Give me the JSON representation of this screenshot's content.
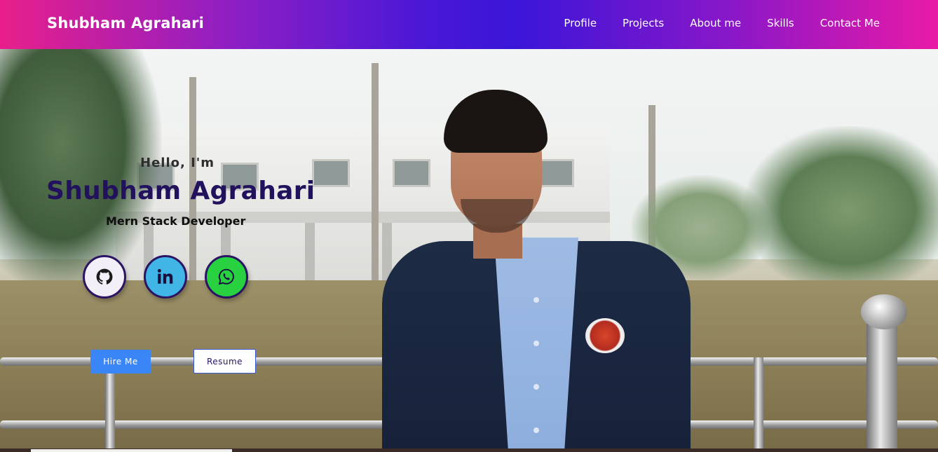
{
  "navbar": {
    "brand": "Shubham Agrahari",
    "links": [
      {
        "label": "Profile"
      },
      {
        "label": "Projects"
      },
      {
        "label": "About me"
      },
      {
        "label": "Skills"
      },
      {
        "label": "Contact Me"
      }
    ]
  },
  "hero": {
    "greeting": "Hello, I'm",
    "name": "Shubham Agrahari",
    "role": "Mern Stack Developer",
    "social": [
      {
        "name": "github-icon"
      },
      {
        "name": "linkedin-icon"
      },
      {
        "name": "whatsapp-icon"
      }
    ],
    "buttons": {
      "hire": "Hire Me",
      "resume": "Resume"
    }
  },
  "colors": {
    "nav_gradient_start": "#e81f8b",
    "nav_gradient_mid": "#3a16d8",
    "nav_gradient_end": "#e91aa6",
    "name_color": "#22115c",
    "hire_button": "#3a86f7",
    "linkedin": "#41b6e6",
    "whatsapp": "#27d13f"
  }
}
